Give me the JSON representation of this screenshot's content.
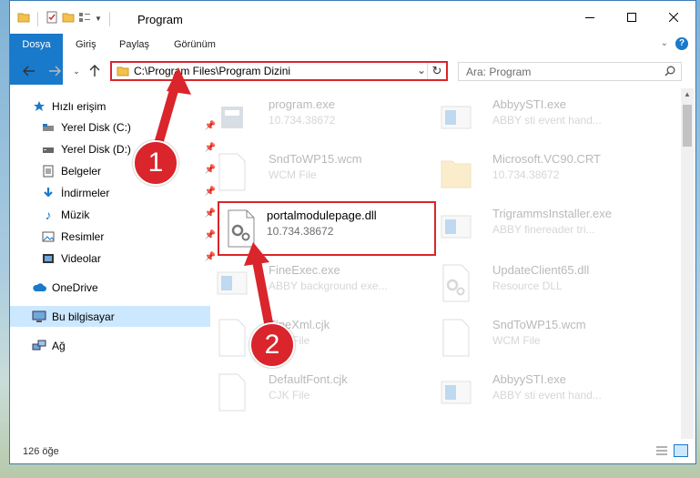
{
  "window": {
    "title": "Program"
  },
  "ribbon": {
    "tabs": [
      "Dosya",
      "Giriş",
      "Paylaş",
      "Görünüm"
    ]
  },
  "address": {
    "path": "C:\\Program Files\\Program Dizini"
  },
  "search": {
    "placeholder": "Ara: Program"
  },
  "nav": {
    "quick_access": "Hızlı erişim",
    "items": [
      {
        "label": "Yerel Disk (C:)",
        "icon": "drive-icon"
      },
      {
        "label": "Yerel Disk (D:)",
        "icon": "drive-icon"
      },
      {
        "label": "Belgeler",
        "icon": "documents-icon"
      },
      {
        "label": "İndirmeler",
        "icon": "download-icon"
      },
      {
        "label": "Müzik",
        "icon": "music-icon"
      },
      {
        "label": "Resimler",
        "icon": "pictures-icon"
      },
      {
        "label": "Videolar",
        "icon": "videos-icon"
      }
    ],
    "onedrive": "OneDrive",
    "this_pc": "Bu bilgisayar",
    "network": "Ağ"
  },
  "files": [
    {
      "name": "program.exe",
      "meta": "10.734.38672"
    },
    {
      "name": "AbbyySTI.exe",
      "meta": "ABBY sti event hand..."
    },
    {
      "name": "SndToWP15.wcm",
      "meta": "WCM File"
    },
    {
      "name": "Microsoft.VC90.CRT",
      "meta": "10.734.38672"
    },
    {
      "name": "portalmodulepage.dll",
      "meta": "10.734.38672"
    },
    {
      "name": "TrigrammsInstaller.exe",
      "meta": "ABBY finereader tri..."
    },
    {
      "name": "FineExec.exe",
      "meta": "ABBY background exe..."
    },
    {
      "name": "UpdateClient65.dll",
      "meta": "Resource DLL"
    },
    {
      "name": "FineXml.cjk",
      "meta": "CJK File"
    },
    {
      "name": "SndToWP15.wcm",
      "meta": "WCM File"
    },
    {
      "name": "DefaultFont.cjk",
      "meta": "CJK File"
    },
    {
      "name": "AbbyySTI.exe",
      "meta": "ABBY sti event hand..."
    }
  ],
  "status": {
    "count": "126 öğe"
  },
  "annotations": {
    "step1": "1",
    "step2": "2"
  },
  "colors": {
    "accent": "#1979ca",
    "highlight": "#d9252b",
    "selection": "#cce8ff"
  }
}
